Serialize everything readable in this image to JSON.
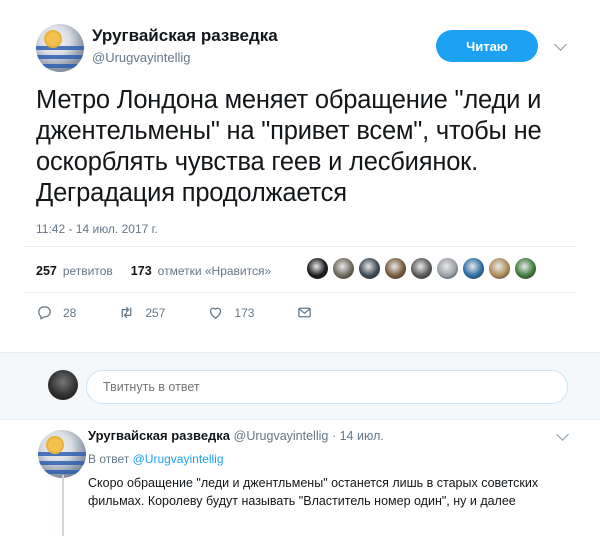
{
  "tweet": {
    "author_name": "Уругвайская разведка",
    "author_handle": "@Urugvayintellig",
    "follow_label": "Читаю",
    "text": "Метро Лондона меняет обращение \"леди и джентельмены\" на \"привет всем\", чтобы не оскорблять чувства геев и лесбиянок. Деградация продолжается",
    "timestamp": "11:42 - 14 июл. 2017 г.",
    "retweets_count": "257",
    "retweets_label": "ретвитов",
    "likes_count": "173",
    "likes_label": "отметки «Нравится»",
    "actions": {
      "reply_count": "28",
      "retweet_count": "257",
      "like_count": "173"
    }
  },
  "reply_box": {
    "placeholder": "Твитнуть в ответ"
  },
  "reply": {
    "author_name": "Уругвайская разведка",
    "author_handle": "@Urugvayintellig",
    "date": "14 июл.",
    "in_reply_prefix": "В ответ",
    "in_reply_handle": "@Urugvayintellig",
    "text": "Скоро обращение \"леди и джентльмены\" останется лишь в старых советских фильмах. Королеву будут называть \"Властитель номер один\", ну и далее"
  },
  "colors": {
    "accent": "#1da1f2",
    "muted": "#657786",
    "likers": [
      "#1b1b1b",
      "#6d6a5c",
      "#3c4a55",
      "#7a5a3a",
      "#5a5a5a",
      "#9aa0a6",
      "#2e6da4",
      "#b08c5a",
      "#3f7d3a"
    ]
  },
  "icons": [
    "reply-icon",
    "retweet-icon",
    "like-icon",
    "message-icon",
    "chevron-down-icon"
  ]
}
